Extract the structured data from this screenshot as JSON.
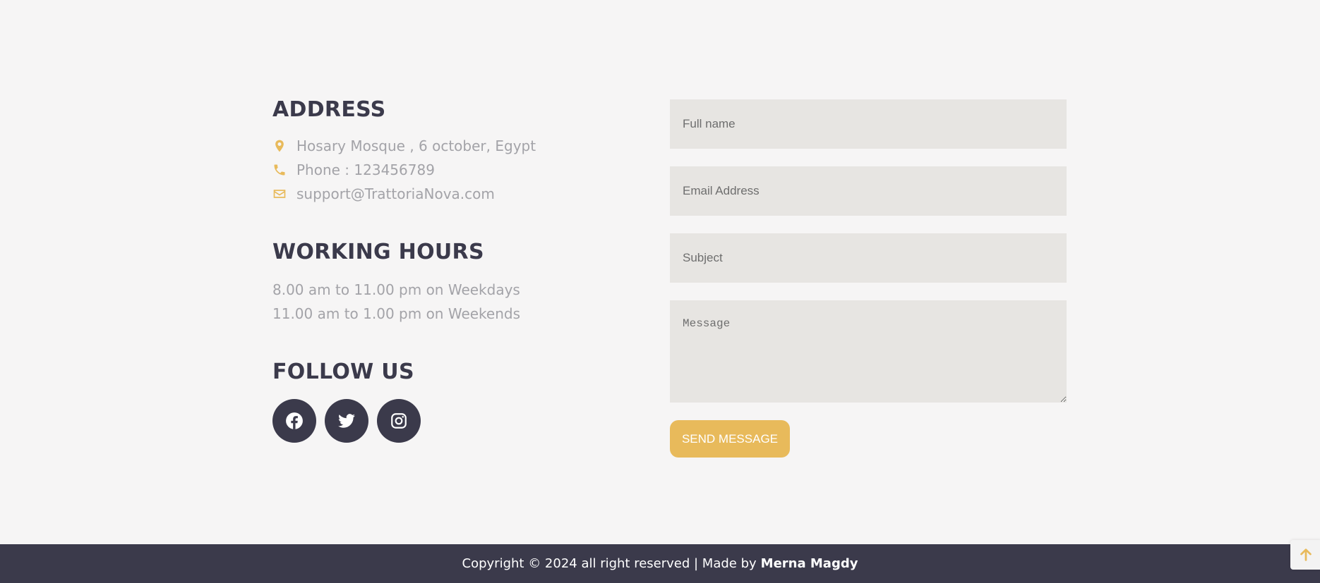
{
  "colors": {
    "accent": "#e8ba5b",
    "dark": "#3b3a4b",
    "muted_text": "#a3a3a8",
    "field_bg": "#e7e5e2",
    "page_bg": "#f6f5f5"
  },
  "address": {
    "heading": "ADDRESS",
    "items": [
      {
        "icon": "map-pin-icon",
        "text": "Hosary Mosque , 6 october, Egypt"
      },
      {
        "icon": "phone-icon",
        "text": "Phone : 123456789"
      },
      {
        "icon": "envelope-icon",
        "text": "support@TrattoriaNova.com"
      }
    ]
  },
  "hours": {
    "heading": "WORKING HOURS",
    "lines": [
      "8.00 am to 11.00 pm on Weekdays",
      "11.00 am to 1.00 pm on Weekends"
    ]
  },
  "follow": {
    "heading": "FOLLOW US",
    "icons": [
      "facebook-icon",
      "twitter-icon",
      "instagram-icon"
    ]
  },
  "form": {
    "name_placeholder": "Full name",
    "email_placeholder": "Email Address",
    "subject_placeholder": "Subject",
    "message_placeholder": "Message",
    "send_label": "SEND MESSAGE"
  },
  "footer": {
    "copyright": "Copyright © 2024 all right reserved | Made by",
    "author": "Merna Magdy"
  },
  "back_to_top_icon": "arrow-up-icon"
}
